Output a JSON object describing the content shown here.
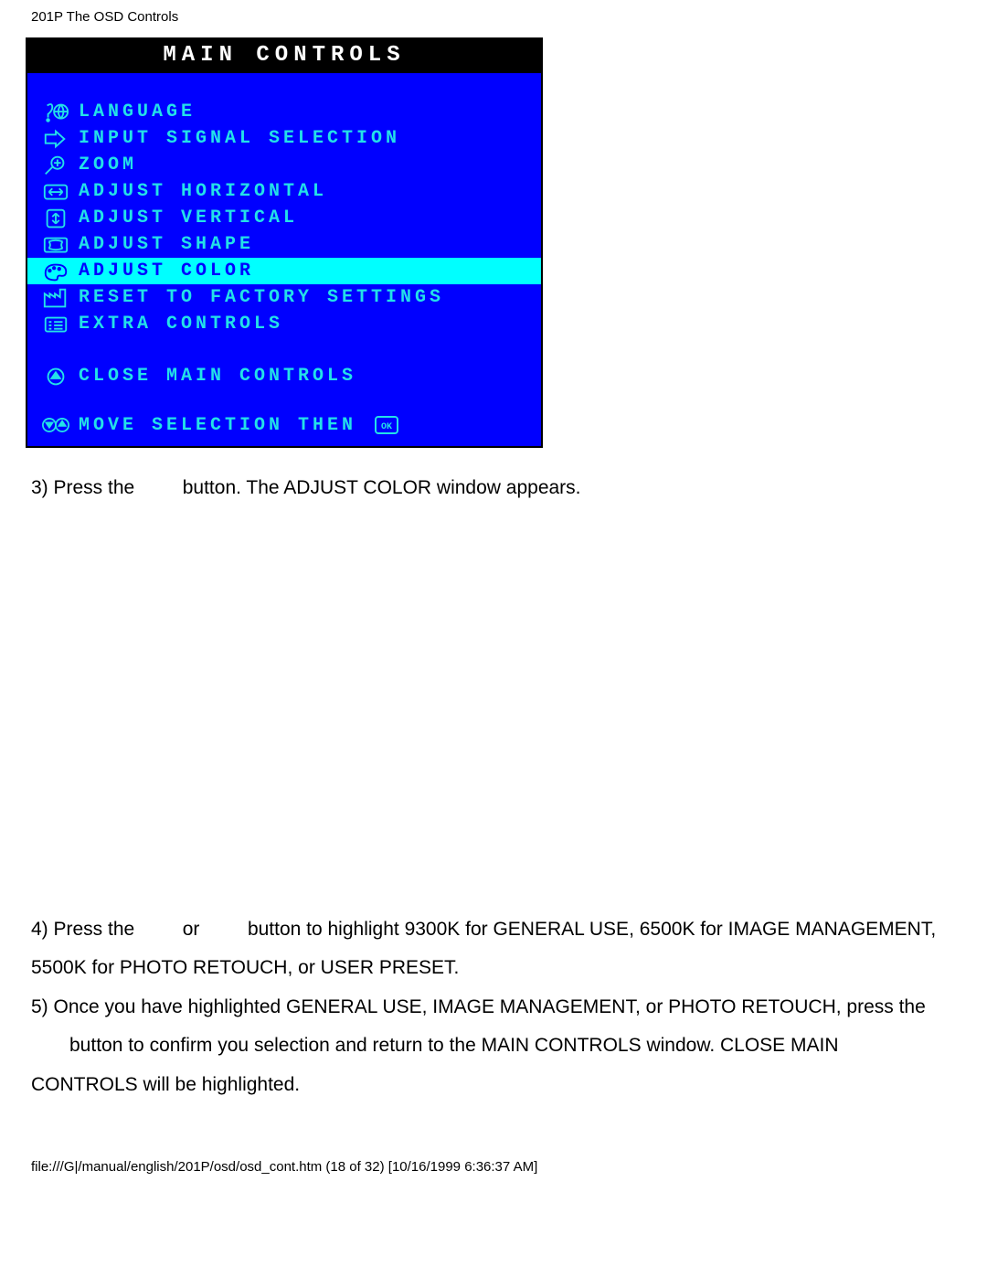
{
  "header": {
    "title": "201P The OSD Controls"
  },
  "osd": {
    "title": "MAIN CONTROLS",
    "items": [
      {
        "label": "LANGUAGE"
      },
      {
        "label": "INPUT SIGNAL SELECTION"
      },
      {
        "label": "ZOOM"
      },
      {
        "label": "ADJUST HORIZONTAL"
      },
      {
        "label": "ADJUST VERTICAL"
      },
      {
        "label": "ADJUST SHAPE"
      },
      {
        "label": "ADJUST COLOR"
      },
      {
        "label": "RESET TO FACTORY SETTINGS"
      },
      {
        "label": "EXTRA CONTROLS"
      }
    ],
    "close_label": "CLOSE MAIN CONTROLS",
    "footer_label": "MOVE SELECTION THEN"
  },
  "body": {
    "step3_a": "3) Press the",
    "step3_b": "button. The ADJUST COLOR window appears.",
    "step4_a": "4) Press the",
    "step4_or": "or",
    "step4_b": "button to highlight 9300K for GENERAL USE, 6500K for IMAGE MANAGEMENT,",
    "step4_c": "5500K for PHOTO RETOUCH, or USER PRESET.",
    "step5_a": "5) Once you have highlighted GENERAL USE, IMAGE MANAGEMENT, or PHOTO RETOUCH, press the",
    "step5_b": "button to confirm you selection and return to the MAIN CONTROLS window. CLOSE MAIN",
    "step5_c": "CONTROLS will be highlighted."
  },
  "footer": {
    "text": "file:///G|/manual/english/201P/osd/osd_cont.htm (18 of 32) [10/16/1999 6:36:37 AM]"
  }
}
